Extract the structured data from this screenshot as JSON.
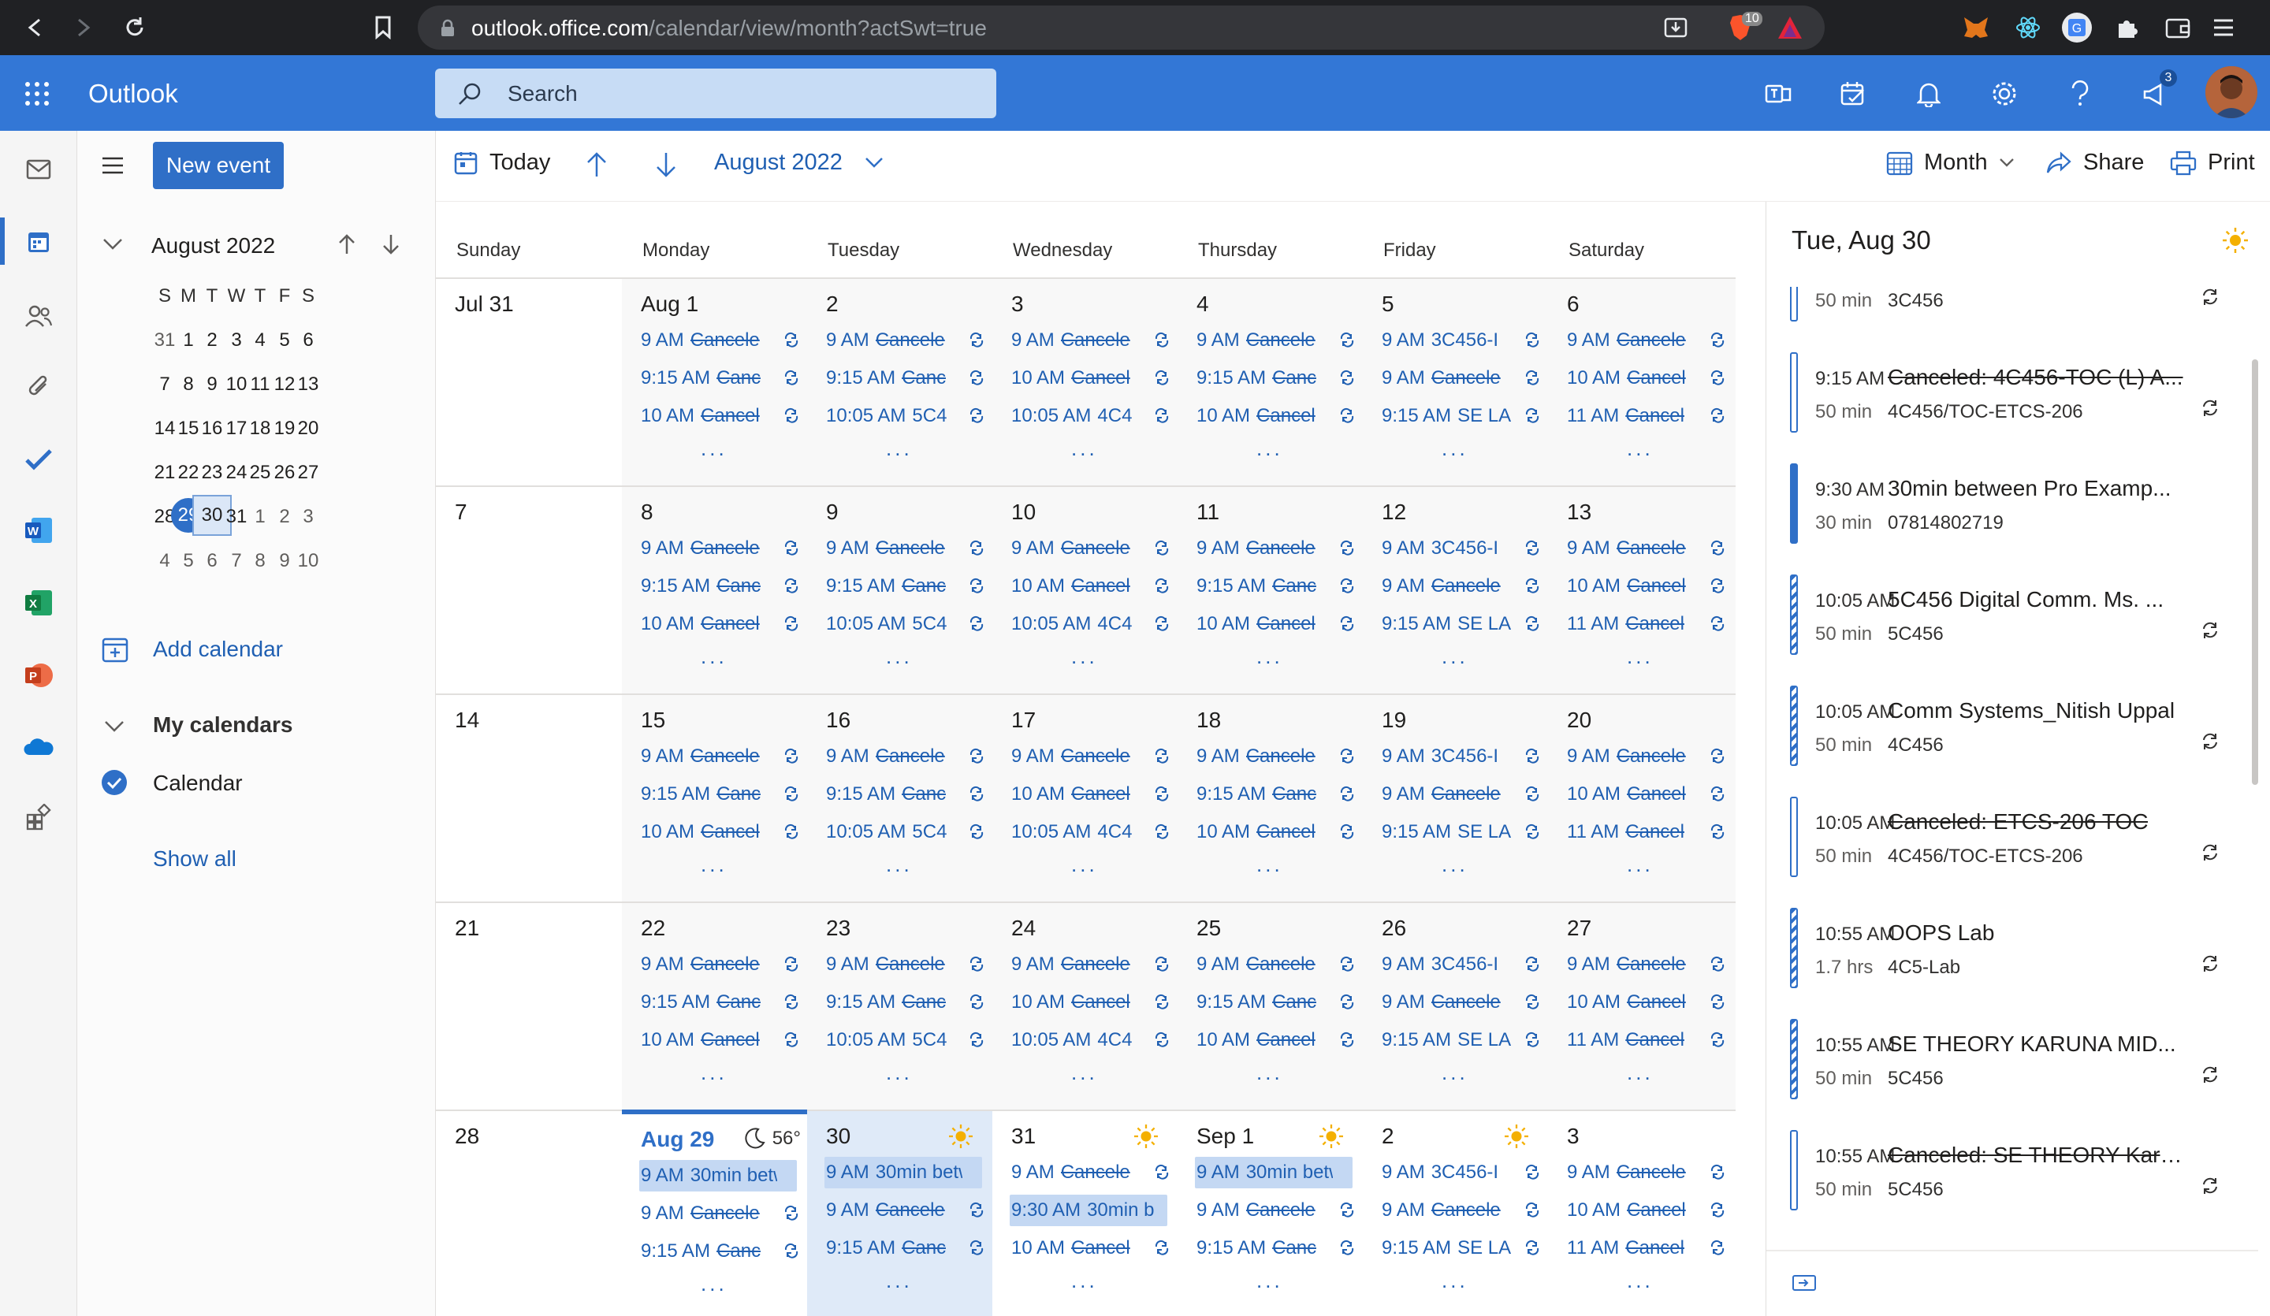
{
  "browser": {
    "url_host": "outlook.office.com",
    "url_path": "/calendar/view/month?actSwt=true",
    "brave_badge": "10",
    "ext_badge": "3"
  },
  "header": {
    "app_name": "Outlook",
    "search_placeholder": "Search"
  },
  "left_pane": {
    "new_event_label": "New event",
    "mini_cal_title": "August 2022",
    "dow": [
      "S",
      "M",
      "T",
      "W",
      "T",
      "F",
      "S"
    ],
    "weeks": [
      [
        "31",
        "1",
        "2",
        "3",
        "4",
        "5",
        "6"
      ],
      [
        "7",
        "8",
        "9",
        "10",
        "11",
        "12",
        "13"
      ],
      [
        "14",
        "15",
        "16",
        "17",
        "18",
        "19",
        "20"
      ],
      [
        "21",
        "22",
        "23",
        "24",
        "25",
        "26",
        "27"
      ],
      [
        "28",
        "29",
        "30",
        "31",
        "1",
        "2",
        "3"
      ],
      [
        "4",
        "5",
        "6",
        "7",
        "8",
        "9",
        "10"
      ]
    ],
    "add_calendar": "Add calendar",
    "my_calendars": "My calendars",
    "calendar_item": "Calendar",
    "show_all": "Show all"
  },
  "toolbar": {
    "today": "Today",
    "range": "August 2022",
    "view": "Month",
    "share": "Share",
    "print": "Print"
  },
  "calendar": {
    "day_headers": [
      "Sunday",
      "Monday",
      "Tuesday",
      "Wednesday",
      "Thursday",
      "Friday",
      "Saturday"
    ],
    "more": "...",
    "weeks": [
      {
        "days": [
          {
            "label": "Jul 31",
            "events": []
          },
          {
            "label": "Aug 1",
            "events": [
              {
                "t": "9 AM",
                "n": "Cancele",
                "x": true
              },
              {
                "t": "9:15 AM",
                "n": "Canc",
                "x": true
              },
              {
                "t": "10 AM",
                "n": "Cancel",
                "x": true
              }
            ]
          },
          {
            "label": "2",
            "events": [
              {
                "t": "9 AM",
                "n": "Cancele",
                "x": true
              },
              {
                "t": "9:15 AM",
                "n": "Canc",
                "x": true
              },
              {
                "t": "10:05 AM",
                "n": "5C4",
                "x": false
              }
            ]
          },
          {
            "label": "3",
            "events": [
              {
                "t": "9 AM",
                "n": "Cancele",
                "x": true
              },
              {
                "t": "10 AM",
                "n": "Cancel",
                "x": true
              },
              {
                "t": "10:05 AM",
                "n": "4C4",
                "x": false
              }
            ]
          },
          {
            "label": "4",
            "events": [
              {
                "t": "9 AM",
                "n": "Cancele",
                "x": true
              },
              {
                "t": "9:15 AM",
                "n": "Canc",
                "x": true
              },
              {
                "t": "10 AM",
                "n": "Cancel",
                "x": true
              }
            ]
          },
          {
            "label": "5",
            "events": [
              {
                "t": "9 AM",
                "n": "3C456-I",
                "x": false
              },
              {
                "t": "9 AM",
                "n": "Cancele",
                "x": true
              },
              {
                "t": "9:15 AM",
                "n": "SE LA",
                "x": false
              }
            ]
          },
          {
            "label": "6",
            "events": [
              {
                "t": "9 AM",
                "n": "Cancele",
                "x": true
              },
              {
                "t": "10 AM",
                "n": "Cancel",
                "x": true
              },
              {
                "t": "11 AM",
                "n": "Cancel",
                "x": true
              }
            ]
          }
        ]
      },
      {
        "days": [
          {
            "label": "7",
            "events": []
          },
          {
            "label": "8",
            "events": [
              {
                "t": "9 AM",
                "n": "Cancele",
                "x": true
              },
              {
                "t": "9:15 AM",
                "n": "Canc",
                "x": true
              },
              {
                "t": "10 AM",
                "n": "Cancel",
                "x": true
              }
            ]
          },
          {
            "label": "9",
            "events": [
              {
                "t": "9 AM",
                "n": "Cancele",
                "x": true
              },
              {
                "t": "9:15 AM",
                "n": "Canc",
                "x": true
              },
              {
                "t": "10:05 AM",
                "n": "5C4",
                "x": false
              }
            ]
          },
          {
            "label": "10",
            "events": [
              {
                "t": "9 AM",
                "n": "Cancele",
                "x": true
              },
              {
                "t": "10 AM",
                "n": "Cancel",
                "x": true
              },
              {
                "t": "10:05 AM",
                "n": "4C4",
                "x": false
              }
            ]
          },
          {
            "label": "11",
            "events": [
              {
                "t": "9 AM",
                "n": "Cancele",
                "x": true
              },
              {
                "t": "9:15 AM",
                "n": "Canc",
                "x": true
              },
              {
                "t": "10 AM",
                "n": "Cancel",
                "x": true
              }
            ]
          },
          {
            "label": "12",
            "events": [
              {
                "t": "9 AM",
                "n": "3C456-I",
                "x": false
              },
              {
                "t": "9 AM",
                "n": "Cancele",
                "x": true
              },
              {
                "t": "9:15 AM",
                "n": "SE LA",
                "x": false
              }
            ]
          },
          {
            "label": "13",
            "events": [
              {
                "t": "9 AM",
                "n": "Cancele",
                "x": true
              },
              {
                "t": "10 AM",
                "n": "Cancel",
                "x": true
              },
              {
                "t": "11 AM",
                "n": "Cancel",
                "x": true
              }
            ]
          }
        ]
      },
      {
        "days": [
          {
            "label": "14",
            "events": []
          },
          {
            "label": "15",
            "events": [
              {
                "t": "9 AM",
                "n": "Cancele",
                "x": true
              },
              {
                "t": "9:15 AM",
                "n": "Canc",
                "x": true
              },
              {
                "t": "10 AM",
                "n": "Cancel",
                "x": true
              }
            ]
          },
          {
            "label": "16",
            "events": [
              {
                "t": "9 AM",
                "n": "Cancele",
                "x": true
              },
              {
                "t": "9:15 AM",
                "n": "Canc",
                "x": true
              },
              {
                "t": "10:05 AM",
                "n": "5C4",
                "x": false
              }
            ]
          },
          {
            "label": "17",
            "events": [
              {
                "t": "9 AM",
                "n": "Cancele",
                "x": true
              },
              {
                "t": "10 AM",
                "n": "Cancel",
                "x": true
              },
              {
                "t": "10:05 AM",
                "n": "4C4",
                "x": false
              }
            ]
          },
          {
            "label": "18",
            "events": [
              {
                "t": "9 AM",
                "n": "Cancele",
                "x": true
              },
              {
                "t": "9:15 AM",
                "n": "Canc",
                "x": true
              },
              {
                "t": "10 AM",
                "n": "Cancel",
                "x": true
              }
            ]
          },
          {
            "label": "19",
            "events": [
              {
                "t": "9 AM",
                "n": "3C456-I",
                "x": false
              },
              {
                "t": "9 AM",
                "n": "Cancele",
                "x": true
              },
              {
                "t": "9:15 AM",
                "n": "SE LA",
                "x": false
              }
            ]
          },
          {
            "label": "20",
            "events": [
              {
                "t": "9 AM",
                "n": "Cancele",
                "x": true
              },
              {
                "t": "10 AM",
                "n": "Cancel",
                "x": true
              },
              {
                "t": "11 AM",
                "n": "Cancel",
                "x": true
              }
            ]
          }
        ]
      },
      {
        "days": [
          {
            "label": "21",
            "events": []
          },
          {
            "label": "22",
            "events": [
              {
                "t": "9 AM",
                "n": "Cancele",
                "x": true
              },
              {
                "t": "9:15 AM",
                "n": "Canc",
                "x": true
              },
              {
                "t": "10 AM",
                "n": "Cancel",
                "x": true
              }
            ]
          },
          {
            "label": "23",
            "events": [
              {
                "t": "9 AM",
                "n": "Cancele",
                "x": true
              },
              {
                "t": "9:15 AM",
                "n": "Canc",
                "x": true
              },
              {
                "t": "10:05 AM",
                "n": "5C4",
                "x": false
              }
            ]
          },
          {
            "label": "24",
            "events": [
              {
                "t": "9 AM",
                "n": "Cancele",
                "x": true
              },
              {
                "t": "10 AM",
                "n": "Cancel",
                "x": true
              },
              {
                "t": "10:05 AM",
                "n": "4C4",
                "x": false
              }
            ]
          },
          {
            "label": "25",
            "events": [
              {
                "t": "9 AM",
                "n": "Cancele",
                "x": true
              },
              {
                "t": "9:15 AM",
                "n": "Canc",
                "x": true
              },
              {
                "t": "10 AM",
                "n": "Cancel",
                "x": true
              }
            ]
          },
          {
            "label": "26",
            "events": [
              {
                "t": "9 AM",
                "n": "3C456-I",
                "x": false
              },
              {
                "t": "9 AM",
                "n": "Cancele",
                "x": true
              },
              {
                "t": "9:15 AM",
                "n": "SE LA",
                "x": false
              }
            ]
          },
          {
            "label": "27",
            "events": [
              {
                "t": "9 AM",
                "n": "Cancele",
                "x": true
              },
              {
                "t": "10 AM",
                "n": "Cancel",
                "x": true
              },
              {
                "t": "11 AM",
                "n": "Cancel",
                "x": true
              }
            ]
          }
        ]
      },
      {
        "days": [
          {
            "label": "28",
            "events": []
          },
          {
            "label": "Aug 29",
            "current": true,
            "weather": "moon",
            "temp": "56°",
            "events": [
              {
                "t": "9 AM",
                "n": "30min betw",
                "x": false,
                "sel": true
              },
              {
                "t": "9 AM",
                "n": "Cancele",
                "x": true
              },
              {
                "t": "9:15 AM",
                "n": "Canc",
                "x": true
              }
            ]
          },
          {
            "label": "30",
            "highlight": true,
            "weather": "sun",
            "events": [
              {
                "t": "9 AM",
                "n": "30min betw",
                "x": false,
                "sel": true
              },
              {
                "t": "9 AM",
                "n": "Cancele",
                "x": true
              },
              {
                "t": "9:15 AM",
                "n": "Canc",
                "x": true
              }
            ]
          },
          {
            "label": "31",
            "weather": "sun",
            "events": [
              {
                "t": "9 AM",
                "n": "Cancele",
                "x": true
              },
              {
                "t": "9:30 AM",
                "n": "30min b",
                "x": false,
                "sel": true
              },
              {
                "t": "10 AM",
                "n": "Cancel",
                "x": true
              }
            ]
          },
          {
            "label": "Sep 1",
            "weather": "sun",
            "events": [
              {
                "t": "9 AM",
                "n": "30min betw",
                "x": false,
                "sel": true
              },
              {
                "t": "9 AM",
                "n": "Cancele",
                "x": true
              },
              {
                "t": "9:15 AM",
                "n": "Canc",
                "x": true
              }
            ]
          },
          {
            "label": "2",
            "weather": "sun",
            "events": [
              {
                "t": "9 AM",
                "n": "3C456-I",
                "x": false
              },
              {
                "t": "9 AM",
                "n": "Cancele",
                "x": true
              },
              {
                "t": "9:15 AM",
                "n": "SE LA",
                "x": false
              }
            ]
          },
          {
            "label": "3",
            "events": [
              {
                "t": "9 AM",
                "n": "Cancele",
                "x": true
              },
              {
                "t": "10 AM",
                "n": "Cancel",
                "x": true
              },
              {
                "t": "11 AM",
                "n": "Cancel",
                "x": true
              }
            ]
          }
        ]
      }
    ]
  },
  "right_pane": {
    "title": "Tue, Aug 30",
    "items": [
      {
        "time": "",
        "dur": "50 min",
        "title": "",
        "loc": "3C456",
        "bar": "outline",
        "x": false,
        "rep": true
      },
      {
        "time": "9:15 AM",
        "dur": "50 min",
        "title": "Canceled: 4C456-TOC (L) A...",
        "loc": "4C456/TOC-ETCS-206",
        "bar": "outline",
        "x": true,
        "rep": true
      },
      {
        "time": "9:30 AM",
        "dur": "30 min",
        "title": "30min between Pro Examp...",
        "loc": "07814802719",
        "bar": "solid",
        "x": false,
        "rep": false
      },
      {
        "time": "10:05 AM",
        "dur": "50 min",
        "title": "5C456 Digital Comm. Ms. ...",
        "loc": "5C456",
        "bar": "striped",
        "x": false,
        "rep": true
      },
      {
        "time": "10:05 AM",
        "dur": "50 min",
        "title": "Comm Systems_Nitish Uppal",
        "loc": "4C456",
        "bar": "striped",
        "x": false,
        "rep": true
      },
      {
        "time": "10:05 AM",
        "dur": "50 min",
        "title": "Canceled: ETCS-206 TOC",
        "loc": "4C456/TOC-ETCS-206",
        "bar": "outline",
        "x": true,
        "rep": true
      },
      {
        "time": "10:55 AM",
        "dur": "1.7 hrs",
        "title": "OOPS Lab",
        "loc": "4C5-Lab",
        "bar": "striped",
        "x": false,
        "rep": true
      },
      {
        "time": "10:55 AM",
        "dur": "50 min",
        "title": "SE THEORY KARUNA MID...",
        "loc": "5C456",
        "bar": "striped",
        "x": false,
        "rep": true
      },
      {
        "time": "10:55 AM",
        "dur": "50 min",
        "title": "Canceled: SE THEORY Karu...",
        "loc": "5C456",
        "bar": "outline",
        "x": true,
        "rep": true
      }
    ]
  },
  "colors": {
    "accent": "#3377d6",
    "event_text": "#1f5fb2",
    "selection": "#c4d8f3"
  }
}
